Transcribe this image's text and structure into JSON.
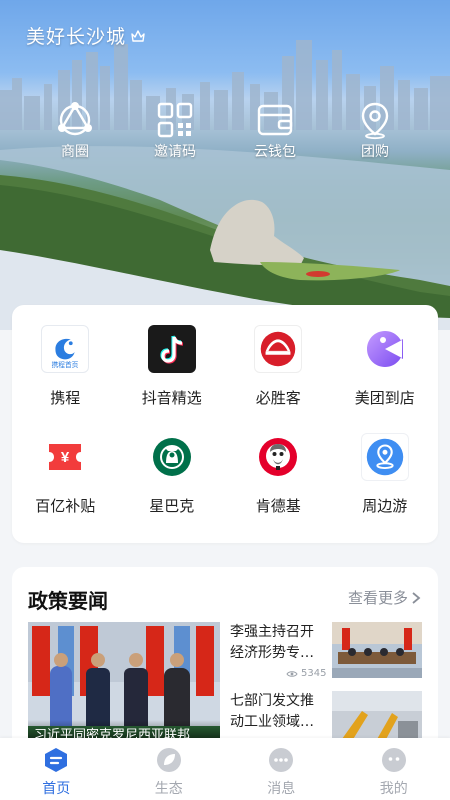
{
  "header": {
    "title": "美好长沙城"
  },
  "quick_actions": [
    {
      "label": "商圈",
      "icon": "business-district-icon"
    },
    {
      "label": "邀请码",
      "icon": "qr-code-icon"
    },
    {
      "label": "云钱包",
      "icon": "wallet-icon"
    },
    {
      "label": "团购",
      "icon": "location-pin-icon"
    }
  ],
  "apps": [
    {
      "label": "携程",
      "icon": "ctrip-icon",
      "badge_text": "携程首页"
    },
    {
      "label": "抖音精选",
      "icon": "douyin-icon"
    },
    {
      "label": "必胜客",
      "icon": "pizza-hut-icon"
    },
    {
      "label": "美团到店",
      "icon": "meituan-icon"
    },
    {
      "label": "百亿补贴",
      "icon": "subsidy-ticket-icon"
    },
    {
      "label": "星巴克",
      "icon": "starbucks-icon"
    },
    {
      "label": "肯德基",
      "icon": "kfc-icon"
    },
    {
      "label": "周边游",
      "icon": "nearby-travel-icon"
    }
  ],
  "news": {
    "title": "政策要闻",
    "more_label": "查看更多",
    "feature_caption": "习近平同密克罗尼西亚联邦",
    "items": [
      {
        "title": "李强主持召开经济形势专…",
        "views": "5345"
      },
      {
        "title": "七部门发文推动工业领域…",
        "views": ""
      }
    ]
  },
  "tabbar": [
    {
      "label": "首页",
      "icon": "home-icon",
      "active": true
    },
    {
      "label": "生态",
      "icon": "ecology-icon",
      "active": false
    },
    {
      "label": "消息",
      "icon": "message-icon",
      "active": false
    },
    {
      "label": "我的",
      "icon": "profile-icon",
      "active": false
    }
  ],
  "colors": {
    "accent": "#2f6fe0",
    "tab_inactive": "#a4a8b0",
    "background": "#f3f5f8"
  }
}
